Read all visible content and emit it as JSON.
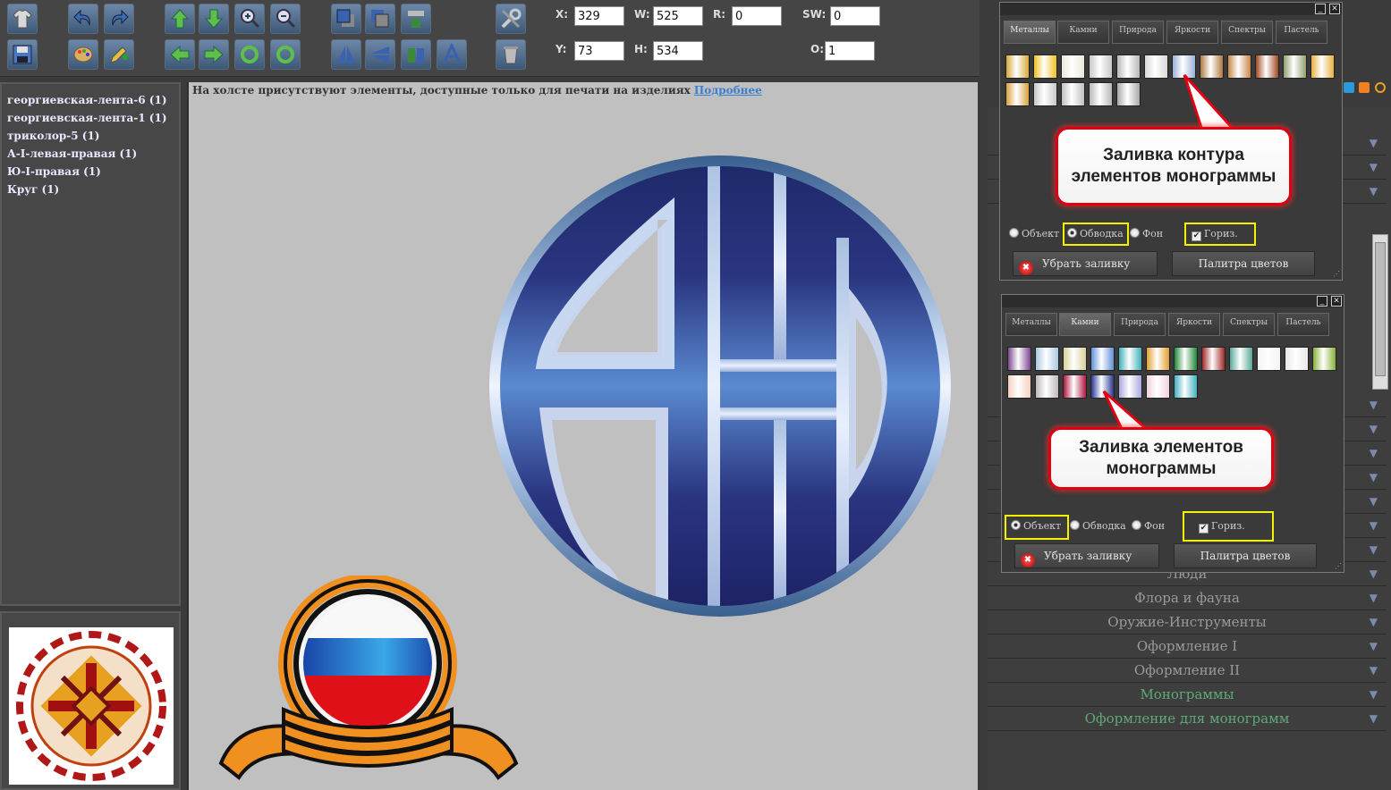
{
  "toolbar": {
    "x_label": "X:",
    "x_value": "329",
    "y_label": "Y:",
    "y_value": "73",
    "w_label": "W:",
    "w_value": "525",
    "h_label": "H:",
    "h_value": "534",
    "r_label": "R:",
    "r_value": "0",
    "sw_label": "SW:",
    "sw_value": "0",
    "o_label": "O:",
    "o_value": "1"
  },
  "layers": [
    "георгиевская-лента-6 (1)",
    "георгиевская-лента-1 (1)",
    "триколор-5 (1)",
    "А-I-левая-правая (1)",
    "Ю-I-правая (1)",
    "Круг (1)"
  ],
  "canvas": {
    "notice": "На холсте присутствуют элементы, доступные только для печати на изделиях",
    "notice_link": "Подробнее"
  },
  "palette_top": {
    "tabs": [
      "Металлы",
      "Камни",
      "Природа",
      "Яркости",
      "Спектры",
      "Пастель"
    ],
    "active_tab": "Металлы",
    "opt_object": "Объект",
    "opt_stroke": "Обводка",
    "opt_bg": "Фон",
    "opt_horiz": "Гориз.",
    "remove_fill": "Убрать заливку",
    "color_palette": "Палитра цветов",
    "swatches": [
      "#d8a838",
      "#f0c020",
      "#ece8d8",
      "#c8c8c8",
      "#b8b8b8",
      "#d8d8d8",
      "#9ab0d8",
      "#b07840",
      "#c88848",
      "#a04820",
      "#90a070",
      "#e8b040",
      "#d8a040",
      "#c8c8c8",
      "#c0c0c0",
      "#b8b8b8",
      "#a8a8a8"
    ]
  },
  "palette_bottom": {
    "tabs": [
      "Металлы",
      "Камни",
      "Природа",
      "Яркости",
      "Спектры",
      "Пастель"
    ],
    "active_tab": "Камни",
    "opt_object": "Объект",
    "opt_stroke": "Обводка",
    "opt_bg": "Фон",
    "opt_horiz": "Гориз.",
    "remove_fill": "Убрать заливку",
    "color_palette": "Палитра цветов",
    "swatches": [
      "#7a4890",
      "#a8c8e0",
      "#d8d098",
      "#6090d8",
      "#40b0b8",
      "#e0a030",
      "#208838",
      "#a02828",
      "#58a898",
      "#f4f4f4",
      "#e8e8e8",
      "#88b038",
      "#f4d0c0",
      "#c0b8b8",
      "#b01840",
      "#283890",
      "#a8a8e0",
      "#f0d0e0",
      "#40b0c0"
    ]
  },
  "callouts": {
    "outline": "Заливка контура элементов монограммы",
    "elements": "Заливка элементов монограммы"
  },
  "categories": [
    {
      "label": "Люди",
      "green": false
    },
    {
      "label": "Флора и фауна",
      "green": false
    },
    {
      "label": "Оружие-Инструменты",
      "green": false
    },
    {
      "label": "Оформление I",
      "green": false
    },
    {
      "label": "Оформление II",
      "green": false
    },
    {
      "label": "Монограммы",
      "green": true
    },
    {
      "label": "Оформление для монограмм",
      "green": true
    }
  ],
  "colors": {
    "callout_border": "#e00010",
    "highlight": "#f4f000",
    "canvas_bg": "#c0c0c0"
  }
}
